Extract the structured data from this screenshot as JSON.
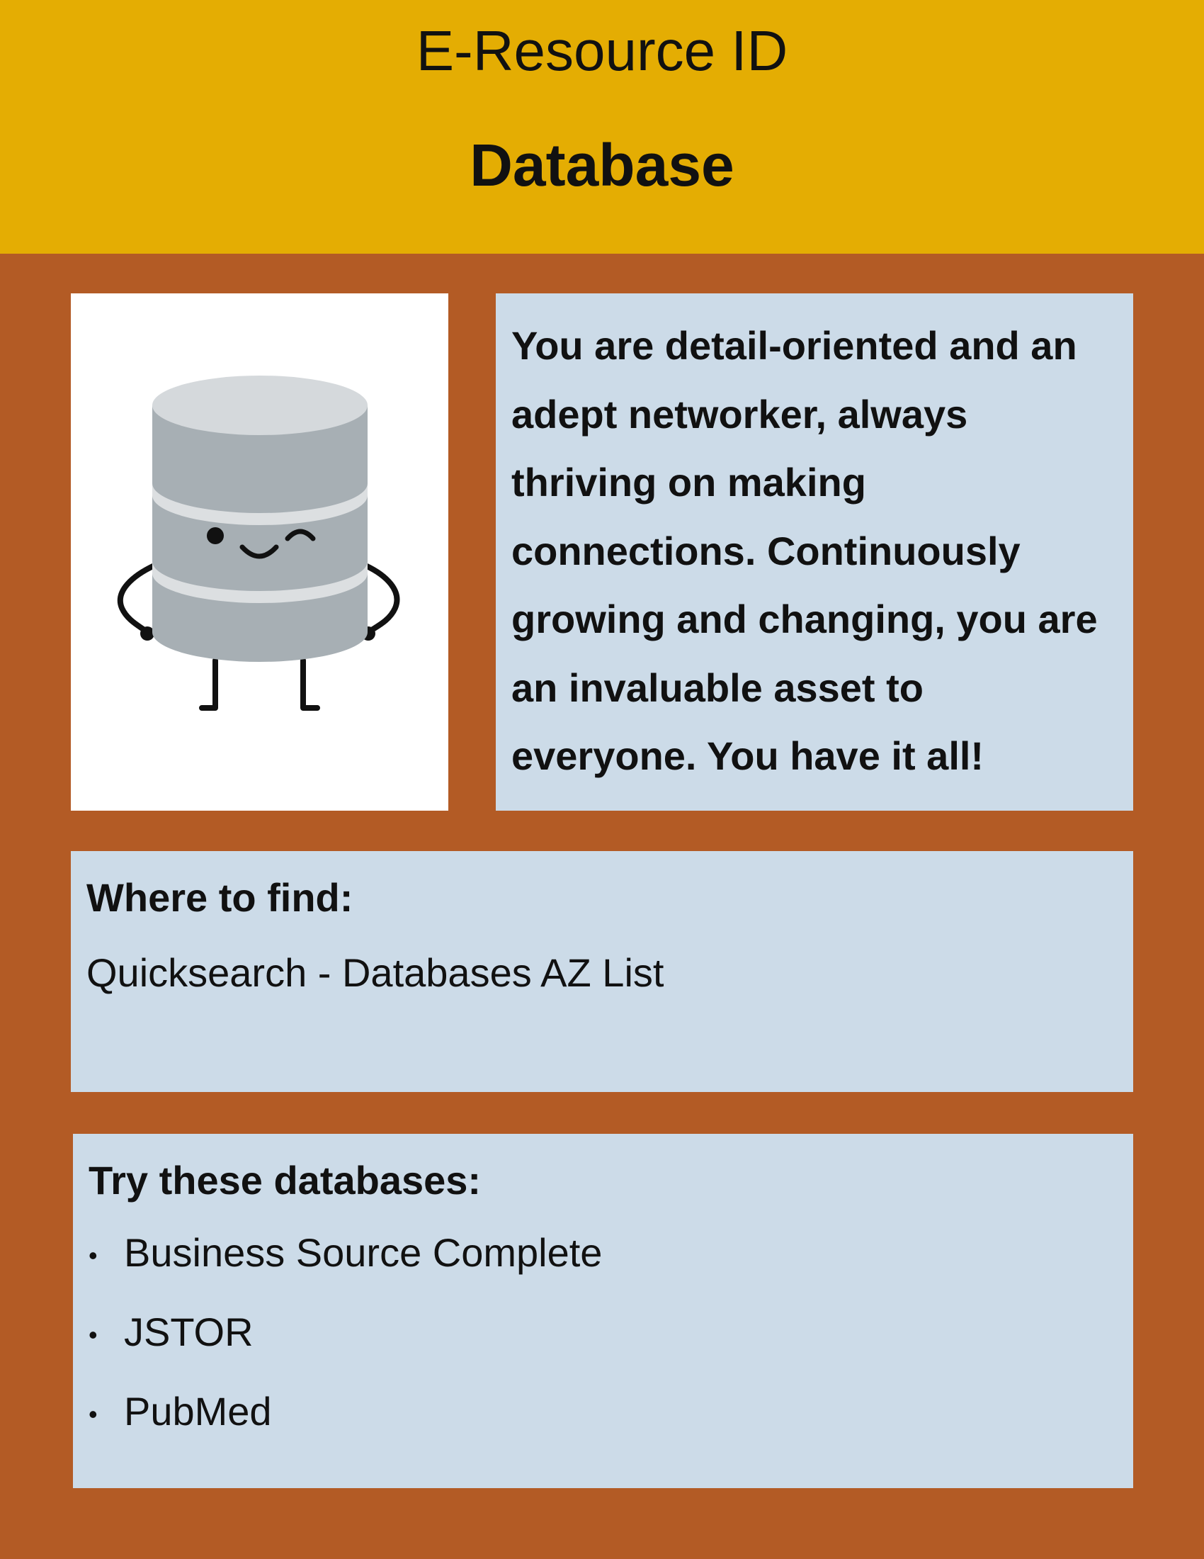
{
  "header": {
    "title": "E-Resource ID",
    "subtitle": "Database"
  },
  "mascot": {
    "icon": "database-mascot-icon"
  },
  "description": {
    "text": "You are detail-oriented and an adept networker, always thriving on making connections. Continuously growing and changing, you are an invaluable asset to everyone. You have it all!"
  },
  "where_to_find": {
    "heading": "Where to find:",
    "value": "Quicksearch - Databases AZ List"
  },
  "try_databases": {
    "heading": "Try these databases:",
    "items": [
      "Business Source Complete",
      "JSTOR",
      "PubMed"
    ]
  },
  "colors": {
    "header_bg": "#e4ad03",
    "page_bg": "#b35b25",
    "panel_bg": "#ccdbe8"
  }
}
